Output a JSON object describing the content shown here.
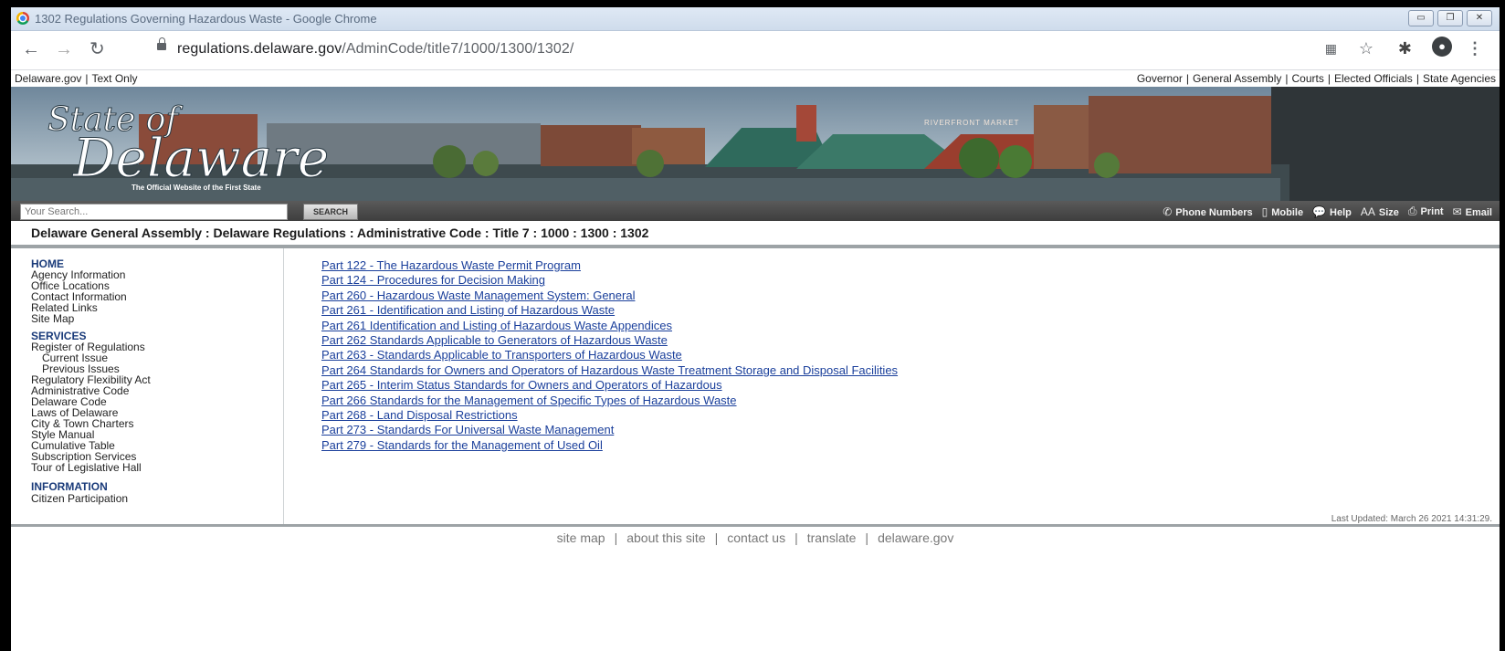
{
  "browser": {
    "tab_title": "1302 Regulations Governing Hazardous Waste - Google Chrome",
    "url_host": "regulations.delaware.gov",
    "url_path": "/AdminCode/title7/1000/1300/1302/",
    "icons": {
      "back": "back-arrow-icon",
      "forward": "forward-arrow-icon",
      "reload": "reload-icon",
      "lock": "lock-icon",
      "extensions": "puzzle-icon",
      "bookmark": "star-icon",
      "profile": "profile-icon",
      "menu": "kebab-menu-icon",
      "qr": "qr-code-icon"
    }
  },
  "topnav": {
    "left": [
      "Delaware.gov",
      "Text Only"
    ],
    "right": [
      "Governor",
      "General Assembly",
      "Courts",
      "Elected Officials",
      "State Agencies"
    ]
  },
  "banner": {
    "logo_line1": "State of",
    "logo_line2": "Delaware",
    "tagline": "The Official Website of the First State",
    "sign": "RIVERFRONT MARKET"
  },
  "searchbar": {
    "placeholder": "Your Search...",
    "button": "SEARCH",
    "tools": [
      "Phone Numbers",
      "Mobile",
      "Help",
      "Size",
      "Print",
      "Email"
    ],
    "size_glyph": "AA"
  },
  "breadcrumb": "Delaware General Assembly : Delaware Regulations : Administrative Code : Title 7 : 1000 : 1300 : 1302",
  "leftnav": {
    "home": "HOME",
    "home_links": [
      "Agency Information",
      "Office Locations",
      "Contact Information",
      "Related Links",
      "Site Map"
    ],
    "services": "SERVICES",
    "services_links": [
      "Register of Regulations",
      "Current Issue",
      "Previous Issues",
      "Regulatory Flexibility Act",
      "Administrative Code",
      "Delaware Code",
      "Laws of Delaware",
      "City & Town Charters",
      "Style Manual",
      "Cumulative Table",
      "Subscription Services",
      "Tour of Legislative Hall"
    ],
    "information": "INFORMATION",
    "information_links": [
      "Citizen Participation"
    ]
  },
  "parts": [
    "Part 122 - The Hazardous Waste Permit Program",
    "Part 124 - Procedures for Decision Making",
    "Part 260 - Hazardous Waste Management System: General",
    "Part 261 - Identification and Listing of Hazardous Waste",
    "Part 261 Identification and Listing of Hazardous Waste Appendices",
    "Part 262 Standards Applicable to Generators of Hazardous Waste",
    "Part 263 - Standards Applicable to Transporters of Hazardous Waste",
    "Part 264 Standards for Owners and Operators of Hazardous Waste Treatment Storage and Disposal Facilities",
    "Part 265 - Interim Status Standards for Owners and Operators of Hazardous",
    "Part 266 Standards for the Management of Specific Types of Hazardous Waste",
    "Part 268 - Land Disposal Restrictions",
    "Part 273 - Standards For Universal Waste Management",
    "Part 279 - Standards for the Management of Used Oil"
  ],
  "last_updated": "Last Updated: March 26 2021 14:31:29.",
  "footer": [
    "site map",
    "about this site",
    "contact us",
    "translate",
    "delaware.gov"
  ],
  "colors": {
    "link": "#1a3f9b",
    "section": "#1a3b7a",
    "searchbar": "#4a4a4a"
  }
}
